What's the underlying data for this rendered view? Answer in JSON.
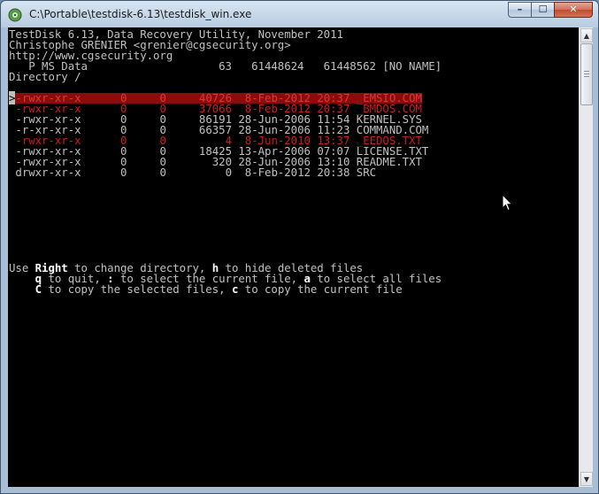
{
  "window": {
    "title": "C:\\Portable\\testdisk-6.13\\testdisk_win.exe",
    "min_label": "–",
    "max_label": "☐",
    "close_label": "✕"
  },
  "console": {
    "header": [
      "TestDisk 6.13, Data Recovery Utility, November 2011",
      "Christophe GRENIER <grenier@cgsecurity.org>",
      "http://www.cgsecurity.org",
      "   P MS Data                    63   61448624   61448562 [NO NAME]",
      "Directory /"
    ],
    "cursor_mark": ">",
    "files": [
      {
        "perm": "-rwxr-xr-x",
        "uid": "0",
        "gid": "0",
        "size": "40726",
        "date": "8-Feb-2012",
        "time": "20:37",
        "name": "_EMSIO.COM",
        "deleted": true
      },
      {
        "perm": "-rwxr-xr-x",
        "uid": "0",
        "gid": "0",
        "size": "37066",
        "date": "8-Feb-2012",
        "time": "20:37",
        "name": "_BMDOS.COM",
        "deleted": true
      },
      {
        "perm": "-rwxr-xr-x",
        "uid": "0",
        "gid": "0",
        "size": "86191",
        "date": "28-Jun-2006",
        "time": "11:54",
        "name": "KERNEL.SYS",
        "deleted": false
      },
      {
        "perm": "-r-xr-xr-x",
        "uid": "0",
        "gid": "0",
        "size": "66357",
        "date": "28-Jun-2006",
        "time": "11:23",
        "name": "COMMAND.COM",
        "deleted": false
      },
      {
        "perm": "-rwxr-xr-x",
        "uid": "0",
        "gid": "0",
        "size": "4",
        "date": "8-Jun-2010",
        "time": "13:37",
        "name": "_EEDOS.TXT",
        "deleted": true
      },
      {
        "perm": "-rwxr-xr-x",
        "uid": "0",
        "gid": "0",
        "size": "18425",
        "date": "13-Apr-2006",
        "time": "07:07",
        "name": "LICENSE.TXT",
        "deleted": false
      },
      {
        "perm": "-rwxr-xr-x",
        "uid": "0",
        "gid": "0",
        "size": "320",
        "date": "28-Jun-2006",
        "time": "13:10",
        "name": "README.TXT",
        "deleted": false
      },
      {
        "perm": "drwxr-xr-x",
        "uid": "0",
        "gid": "0",
        "size": "0",
        "date": "8-Feb-2012",
        "time": "20:38",
        "name": "SRC",
        "deleted": false
      }
    ],
    "help": {
      "l1_a": "Use ",
      "l1_k1": "Right",
      "l1_b": " to change directory, ",
      "l1_k2": "h",
      "l1_c": " to hide deleted files",
      "l2_a": "    ",
      "l2_k1": "q",
      "l2_b": " to quit, ",
      "l2_k2": ":",
      "l2_c": " to select the current file, ",
      "l2_k3": "a",
      "l2_d": " to select all files",
      "l3_a": "    ",
      "l3_k1": "C",
      "l3_b": " to copy the selected files, ",
      "l3_k2": "c",
      "l3_c": " to copy the current file"
    }
  },
  "colors": {
    "deleted": "#c81e1e",
    "selected_bg": "#8b0c0c",
    "normal": "#c0c0c0"
  },
  "icons": {
    "app": "testdisk-app-icon",
    "pointer": "mouse-pointer-icon"
  }
}
